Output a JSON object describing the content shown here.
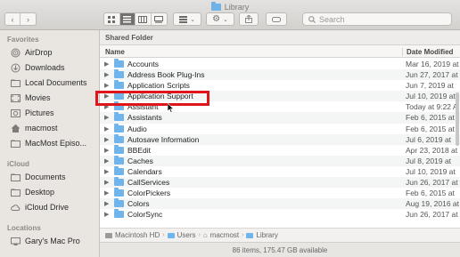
{
  "window": {
    "title": "Library"
  },
  "search": {
    "placeholder": "Search"
  },
  "sidebar": {
    "favorites_header": "Favorites",
    "favorites": [
      {
        "label": "AirDrop",
        "icon": "airdrop-icon"
      },
      {
        "label": "Downloads",
        "icon": "downloads-icon"
      },
      {
        "label": "Local Documents",
        "icon": "folder-icon"
      },
      {
        "label": "Movies",
        "icon": "movies-icon"
      },
      {
        "label": "Pictures",
        "icon": "pictures-icon"
      },
      {
        "label": "macmost",
        "icon": "home-icon"
      },
      {
        "label": "MacMost Episo...",
        "icon": "folder-icon"
      }
    ],
    "icloud_header": "iCloud",
    "icloud": [
      {
        "label": "Documents",
        "icon": "folder-icon"
      },
      {
        "label": "Desktop",
        "icon": "folder-icon"
      },
      {
        "label": "iCloud Drive",
        "icon": "cloud-icon"
      }
    ],
    "locations_header": "Locations",
    "locations": [
      {
        "label": "Gary's Mac Pro",
        "icon": "computer-icon"
      }
    ]
  },
  "main": {
    "shared_header": "Shared Folder",
    "col_name": "Name",
    "col_date": "Date Modified",
    "files": [
      {
        "name": "Accounts",
        "date": "Mar 16, 2019 at"
      },
      {
        "name": "Address Book Plug-Ins",
        "date": "Jun 27, 2017 at"
      },
      {
        "name": "Application Scripts",
        "date": "Jun 7, 2019 at"
      },
      {
        "name": "Application Support",
        "date": "Jul 10, 2019 at"
      },
      {
        "name": "Assistant",
        "date": "Today at 9:22 A"
      },
      {
        "name": "Assistants",
        "date": "Feb 6, 2015 at"
      },
      {
        "name": "Audio",
        "date": "Feb 6, 2015 at"
      },
      {
        "name": "Autosave Information",
        "date": "Jul 6, 2019 at"
      },
      {
        "name": "BBEdit",
        "date": "Apr 23, 2018 at"
      },
      {
        "name": "Caches",
        "date": "Jul 8, 2019 at"
      },
      {
        "name": "Calendars",
        "date": "Jul 10, 2019 at"
      },
      {
        "name": "CallServices",
        "date": "Jun 26, 2017 at"
      },
      {
        "name": "ColorPickers",
        "date": "Feb 6, 2015 at"
      },
      {
        "name": "Colors",
        "date": "Aug 19, 2016 at"
      },
      {
        "name": "ColorSync",
        "date": "Jun 26, 2017 at"
      }
    ]
  },
  "pathbar": [
    "Macintosh HD",
    "Users",
    "macmost",
    "Library"
  ],
  "status": "86 items, 175.47 GB available"
}
